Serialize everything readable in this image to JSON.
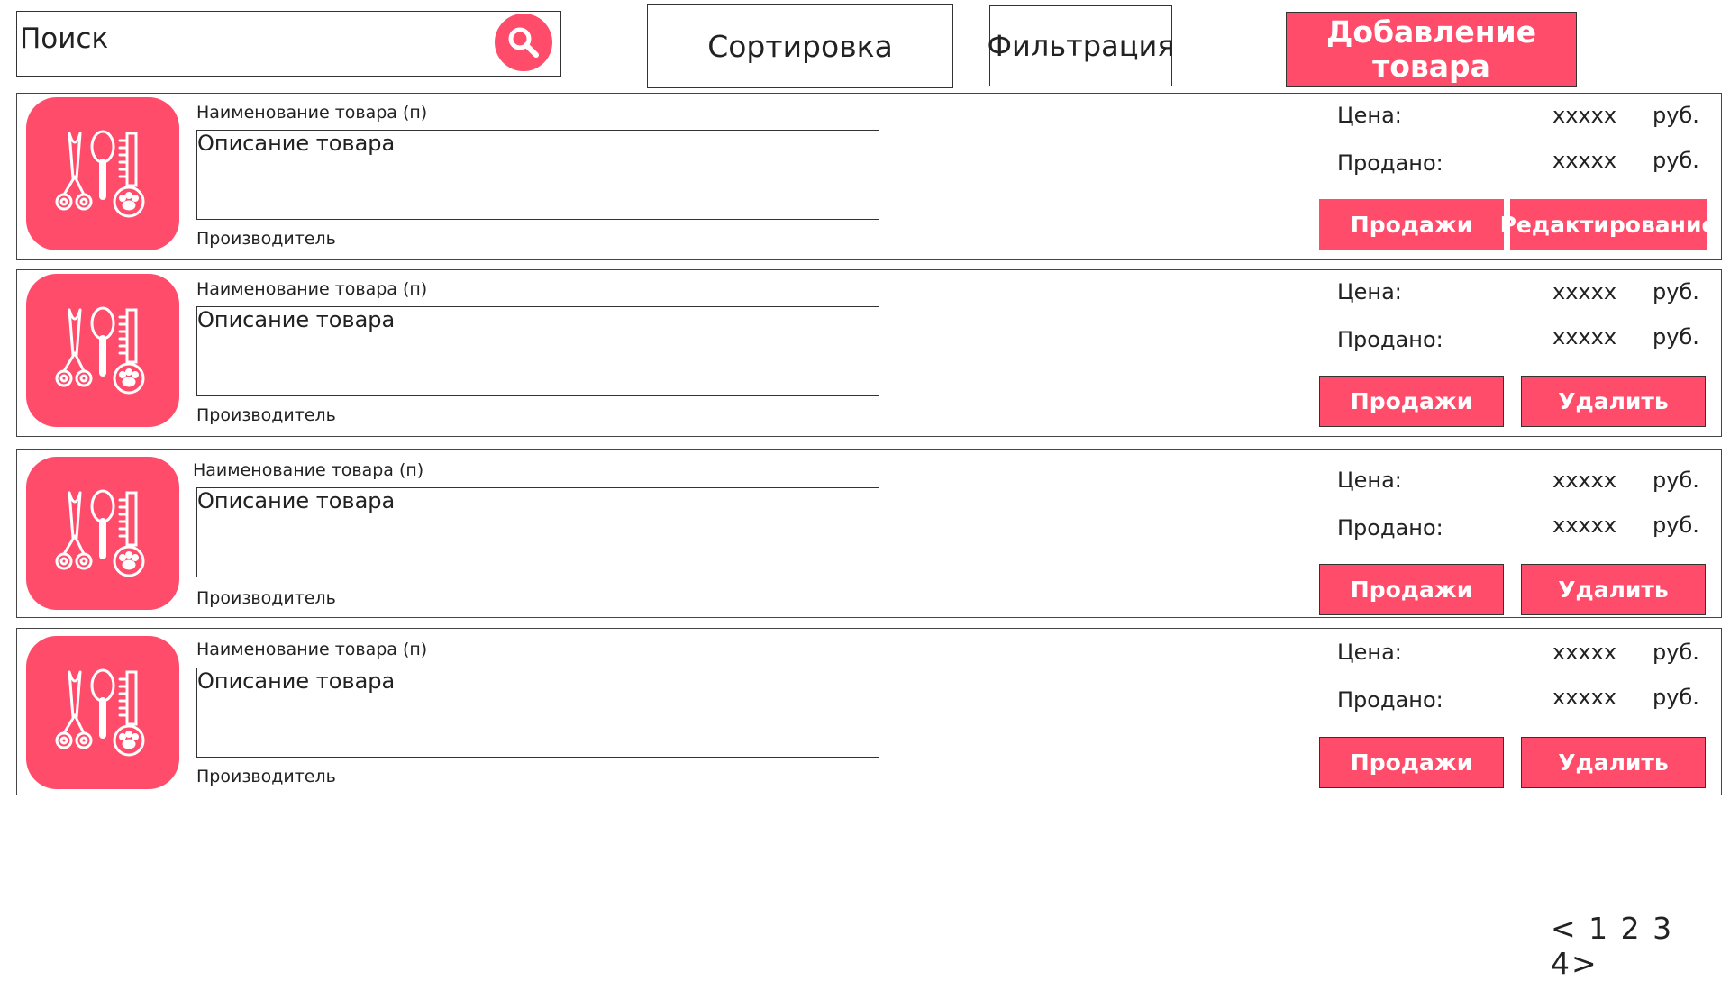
{
  "toolbar": {
    "search_label": "Поиск",
    "sort_label": "Сортировка",
    "filter_label": "Фильтрация",
    "add_label": "Добавление товара"
  },
  "products": [
    {
      "name": "Наименование товара (п)",
      "description": "Описание товара",
      "manufacturer": "Производитель",
      "price_label": "Цена:",
      "price_value": "xxxxx",
      "price_unit": "руб.",
      "sold_label": "Продано:",
      "sold_value": "xxxxx",
      "sold_unit": "руб.",
      "sales_button": "Продажи",
      "action_button": "Редактирование"
    },
    {
      "name": "Наименование товара (п)",
      "description": "Описание товара",
      "manufacturer": "Производитель",
      "price_label": "Цена:",
      "price_value": "xxxxx",
      "price_unit": "руб.",
      "sold_label": "Продано:",
      "sold_value": "xxxxx",
      "sold_unit": "руб.",
      "sales_button": "Продажи",
      "action_button": "Удалить"
    },
    {
      "name": "Наименование товара (п)",
      "description": "Описание товара",
      "manufacturer": "Производитель",
      "price_label": "Цена:",
      "price_value": "xxxxx",
      "price_unit": "руб.",
      "sold_label": "Продано:",
      "sold_value": "xxxxx",
      "sold_unit": "руб.",
      "sales_button": "Продажи",
      "action_button": "Удалить"
    },
    {
      "name": "Наименование товара (п)",
      "description": "Описание товара",
      "manufacturer": "Производитель",
      "price_label": "Цена:",
      "price_value": "xxxxx",
      "price_unit": "руб.",
      "sold_label": "Продано:",
      "sold_value": "xxxxx",
      "sold_unit": "руб.",
      "sales_button": "Продажи",
      "action_button": "Удалить"
    }
  ],
  "pagination": {
    "prev": "<",
    "pages": [
      "1",
      "2",
      "3",
      "4"
    ],
    "next": ">"
  },
  "colors": {
    "accent": "#ff4c6a",
    "border": "#333333"
  },
  "icons": {
    "search": "search-icon",
    "product": "grooming-tools-icon"
  }
}
